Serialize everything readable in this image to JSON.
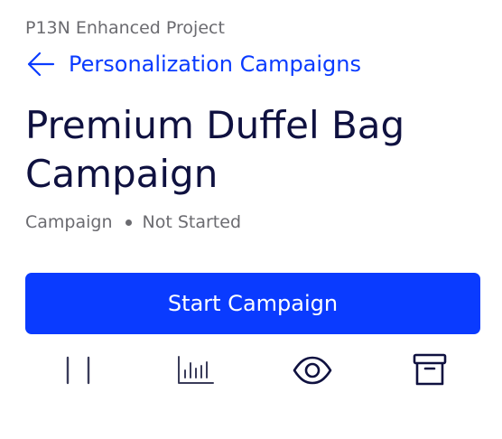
{
  "header": {
    "project_name": "P13N Enhanced Project",
    "back_link_label": "Personalization Campaigns",
    "back_icon": "arrow-left-icon"
  },
  "campaign": {
    "title": "Premium Duffel Bag Campaign",
    "type": "Campaign",
    "status": "Not Started"
  },
  "actions": {
    "start_label": "Start Campaign",
    "icons": [
      "pause-icon",
      "bar-chart-icon",
      "eye-icon",
      "archive-icon"
    ]
  },
  "colors": {
    "primary": "#0a3bff",
    "text_dark": "#0f1140",
    "text_muted": "#6b6b70",
    "background": "#ffffff"
  }
}
